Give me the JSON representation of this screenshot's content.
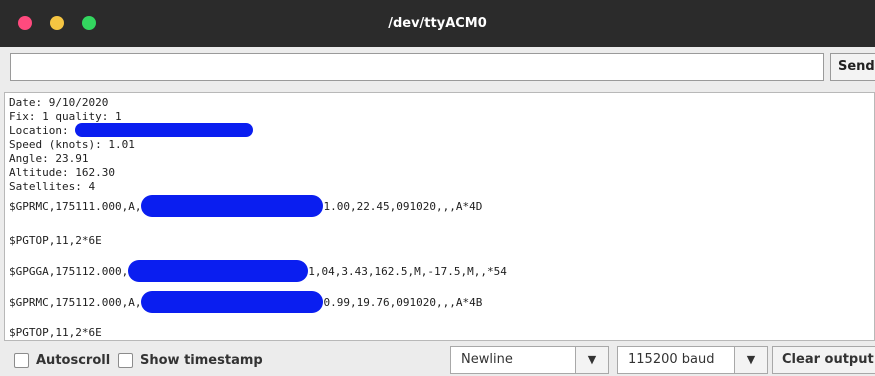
{
  "window": {
    "title": "/dev/ttyACM0"
  },
  "send_bar": {
    "input_value": "",
    "send_label": "Send"
  },
  "output": {
    "lines": [
      "Date: 9/10/2020",
      "Fix: 1 quality: 1",
      "Location: ",
      "Speed (knots): 1.01",
      "Angle: 23.91",
      "Altitude: 162.30",
      "Satellites: 4",
      "$GPRMC,175111.000,A,",
      "1.00,22.45,091020,,,A*4D",
      "$PGTOP,11,2*6E",
      "$GPGGA,175112.000,",
      "1,04,3.43,162.5,M,-17.5,M,,*54",
      "$GPRMC,175112.000,A,",
      "0.99,19.76,091020,,,A*4B",
      "$PGTOP,11,2*6E"
    ]
  },
  "footer": {
    "autoscroll_label": "Autoscroll",
    "autoscroll_checked": false,
    "timestamp_label": "Show timestamp",
    "timestamp_checked": false,
    "line_ending": "Newline",
    "baud_rate": "115200 baud",
    "clear_label": "Clear output"
  },
  "colors": {
    "redaction": "#0a1ef0",
    "titlebar": "#2b2b2b"
  }
}
